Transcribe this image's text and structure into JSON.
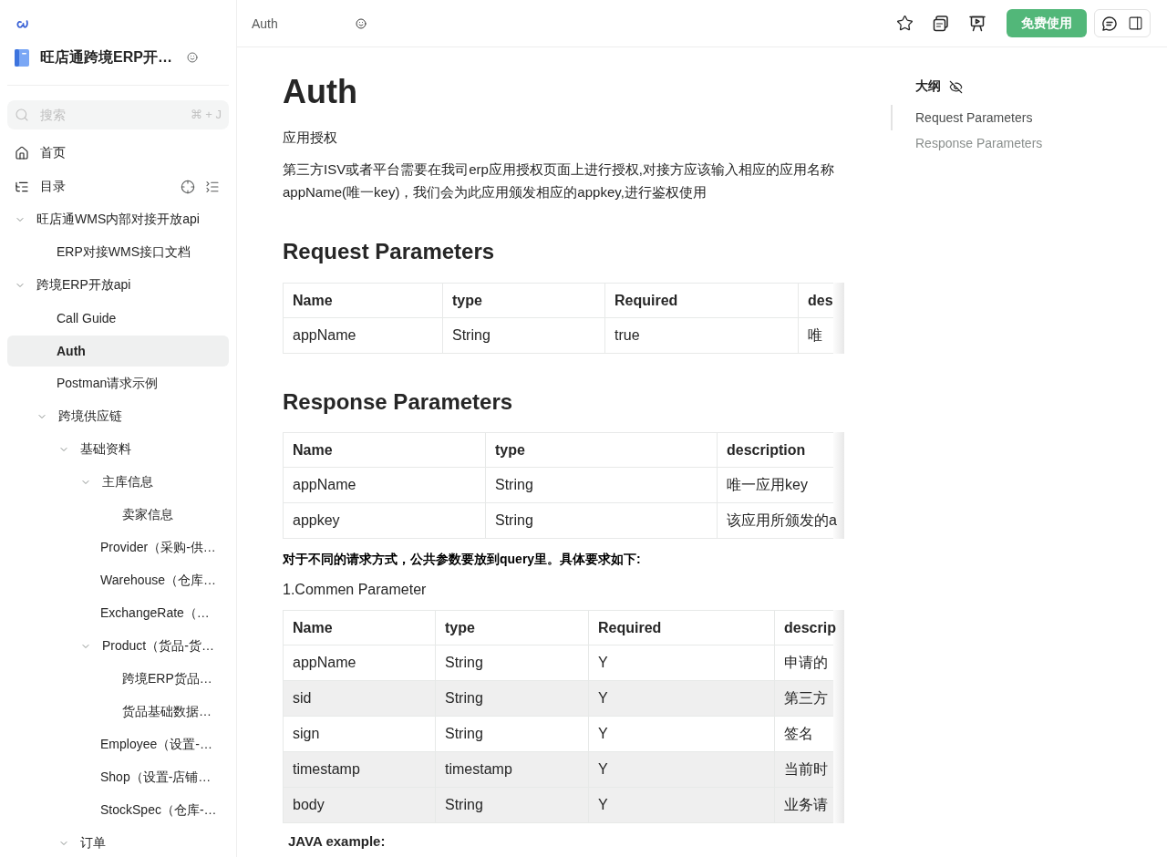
{
  "sidebar": {
    "book_title": "旺店通跨境ERP开…",
    "search": {
      "placeholder": "搜索",
      "shortcut": "⌘ + J"
    },
    "nav": [
      {
        "kind": "home",
        "label": "首页"
      },
      {
        "kind": "toc",
        "label": "目录"
      }
    ],
    "tree": [
      {
        "label": "旺店通WMS内部对接开放api",
        "kind": "folder",
        "expanded": true,
        "selected": false,
        "children": [
          {
            "label": "ERP对接WMS接口文档",
            "kind": "doc",
            "selected": false
          }
        ]
      },
      {
        "label": "跨境ERP开放api",
        "kind": "folder",
        "expanded": true,
        "selected": false,
        "children": [
          {
            "label": "Call Guide",
            "kind": "doc",
            "selected": false
          },
          {
            "label": "Auth",
            "kind": "doc",
            "selected": true
          },
          {
            "label": "Postman请求示例",
            "kind": "doc",
            "selected": false
          },
          {
            "label": "跨境供应链",
            "kind": "folder",
            "expanded": true,
            "selected": false,
            "children": [
              {
                "label": "基础资料",
                "kind": "folder",
                "expanded": true,
                "selected": false,
                "children": [
                  {
                    "label": "主库信息",
                    "kind": "folder",
                    "expanded": true,
                    "selected": false,
                    "children": [
                      {
                        "label": "卖家信息",
                        "kind": "doc",
                        "selected": false
                      }
                    ]
                  },
                  {
                    "label": "Provider（采购-供…",
                    "kind": "doc",
                    "selected": false
                  },
                  {
                    "label": "Warehouse（仓库…",
                    "kind": "doc",
                    "selected": false
                  },
                  {
                    "label": "ExchangeRate（…",
                    "kind": "doc",
                    "selected": false
                  },
                  {
                    "label": "Product（货品-货…",
                    "kind": "folder",
                    "expanded": true,
                    "selected": false,
                    "children": [
                      {
                        "label": "跨境ERP货品…",
                        "kind": "doc",
                        "selected": false
                      },
                      {
                        "label": "货品基础数据…",
                        "kind": "doc",
                        "selected": false
                      }
                    ]
                  },
                  {
                    "label": "Employee（设置-…",
                    "kind": "doc",
                    "selected": false
                  },
                  {
                    "label": "Shop（设置-店铺…",
                    "kind": "doc",
                    "selected": false
                  },
                  {
                    "label": "StockSpec（仓库-…",
                    "kind": "doc",
                    "selected": false
                  }
                ]
              },
              {
                "label": "订单",
                "kind": "folder",
                "expanded": true,
                "selected": false
              }
            ]
          }
        ]
      }
    ]
  },
  "header": {
    "title": "Auth",
    "cta_button": "免费使用"
  },
  "article": {
    "title": "Auth",
    "blocks": [
      {
        "kind": "lead",
        "text": "应用授权"
      },
      {
        "kind": "paragraph",
        "text": "第三方ISV或者平台需要在我司erp应用授权页面上进行授权,对接方应该输入相应的应用名称appName(唯一key)，我们会为此应用颁发相应的appkey,进行鉴权使用"
      },
      {
        "kind": "heading",
        "text": "Request Parameters"
      },
      {
        "kind": "table",
        "columns": [
          "Name",
          "type",
          "Required",
          "des"
        ],
        "rows": [
          {
            "cells": [
              "appName",
              "String",
              "true",
              "唯"
            ],
            "shaded": false
          }
        ]
      },
      {
        "kind": "heading",
        "text": "Response Parameters"
      },
      {
        "kind": "table",
        "columns": [
          "Name",
          "type",
          "description"
        ],
        "rows": [
          {
            "cells": [
              "appName",
              "String",
              "唯一应用key"
            ],
            "shaded": false
          },
          {
            "cells": [
              "appkey",
              "String",
              "该应用所颁发的a"
            ],
            "shaded": false
          }
        ]
      },
      {
        "kind": "strong",
        "text": "对于不同的请求方式，公共参数要放到query里。具体要求如下:"
      },
      {
        "kind": "subheading",
        "text": "1.Commen Parameter"
      },
      {
        "kind": "table",
        "columns": [
          "Name",
          "type",
          "Required",
          "descrip"
        ],
        "rows": [
          {
            "cells": [
              "appName",
              "String",
              "Y",
              "申请的"
            ],
            "shaded": false
          },
          {
            "cells": [
              "sid",
              "String",
              "Y",
              "第三方"
            ],
            "shaded": true
          },
          {
            "cells": [
              "sign",
              "String",
              "Y",
              "签名"
            ],
            "shaded": false
          },
          {
            "cells": [
              "timestamp",
              "timestamp",
              "Y",
              "当前时"
            ],
            "shaded": true
          },
          {
            "cells": [
              "body",
              "String",
              "Y",
              "业务请"
            ],
            "shaded": true
          }
        ]
      },
      {
        "kind": "code_label",
        "text": "JAVA example:"
      }
    ]
  },
  "outline": {
    "title": "大纲",
    "items": [
      {
        "label": "Request Parameters",
        "selected": true
      },
      {
        "label": "Response Parameters",
        "selected": false
      }
    ]
  }
}
